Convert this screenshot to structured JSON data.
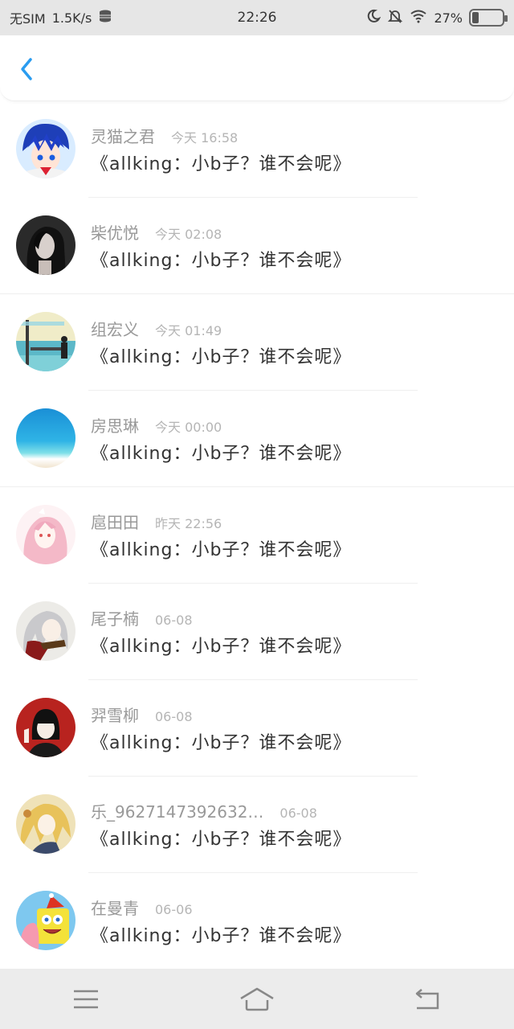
{
  "status_bar": {
    "carrier": "无SIM",
    "speed": "1.5K/s",
    "time": "22:26",
    "battery": "27%",
    "icons": [
      "storage-icon",
      "moon-icon",
      "mute-icon",
      "wifi-icon",
      "battery-icon"
    ]
  },
  "header": {
    "back_icon": "chevron-left-icon",
    "accent_color": "#2a9cf0"
  },
  "items": [
    {
      "name": "灵猫之君",
      "time": "今天 16:58",
      "message": "《allking：小b子？谁不会呢》"
    },
    {
      "name": "柴优悦",
      "time": "今天 02:08",
      "message": "《allking：小b子？谁不会呢》"
    },
    {
      "name": "组宏义",
      "time": "今天 01:49",
      "message": "《allking：小b子？谁不会呢》"
    },
    {
      "name": "房思琳",
      "time": "今天 00:00",
      "message": "《allking：小b子？谁不会呢》"
    },
    {
      "name": "扈田田",
      "time": "昨天 22:56",
      "message": "《allking：小b子？谁不会呢》"
    },
    {
      "name": "尾子楠",
      "time": "06-08",
      "message": "《allking：小b子？谁不会呢》"
    },
    {
      "name": "羿雪柳",
      "time": "06-08",
      "message": "《allking：小b子？谁不会呢》"
    },
    {
      "name": "乐_9627147392632…",
      "time": "06-08",
      "message": "《allking：小b子？谁不会呢》"
    },
    {
      "name": "在曼青",
      "time": "06-06",
      "message": "《allking：小b子？谁不会呢》"
    }
  ],
  "bottom_nav": {
    "icons": [
      "menu-icon",
      "home-icon",
      "back-icon"
    ]
  }
}
